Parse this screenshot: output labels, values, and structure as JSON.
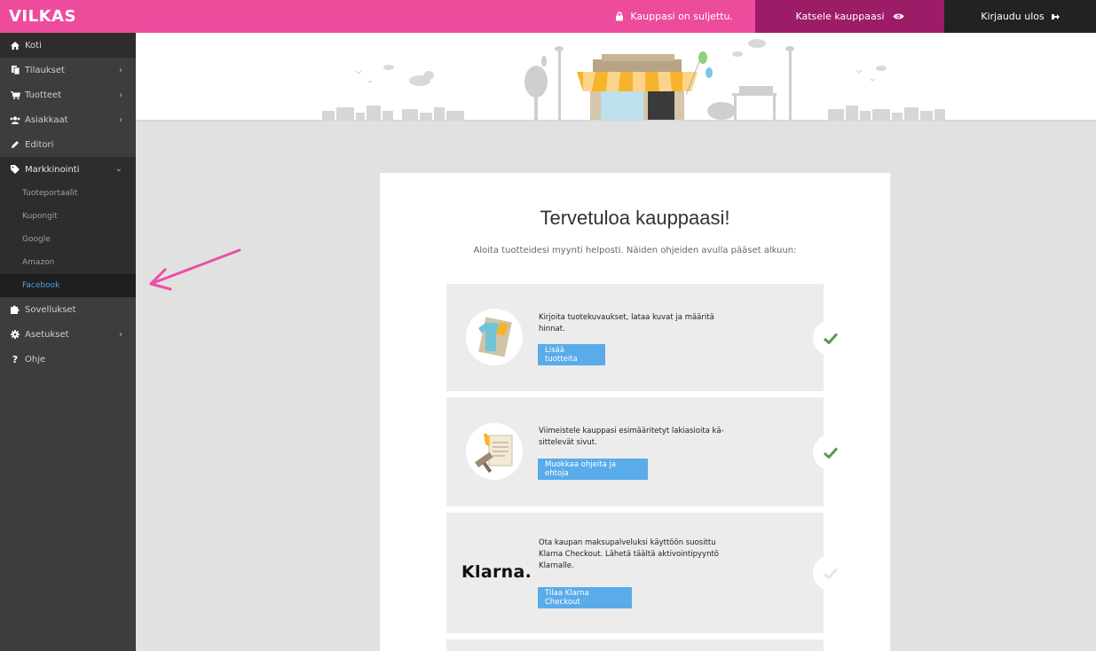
{
  "header": {
    "logo": "VILKAS",
    "store_status": "Kauppasi on suljettu.",
    "view_store": "Katsele kauppaasi",
    "logout": "Kirjaudu ulos"
  },
  "sidebar": {
    "items": [
      {
        "label": "Koti",
        "icon": "home-icon"
      },
      {
        "label": "Tilaukset",
        "icon": "orders-icon"
      },
      {
        "label": "Tuotteet",
        "icon": "cart-icon"
      },
      {
        "label": "Asiakkaat",
        "icon": "users-icon"
      },
      {
        "label": "Editori",
        "icon": "pencil-icon"
      },
      {
        "label": "Markkinointi",
        "icon": "tag-icon"
      },
      {
        "label": "Sovellukset",
        "icon": "puzzle-icon"
      },
      {
        "label": "Asetukset",
        "icon": "gear-icon"
      },
      {
        "label": "Ohje",
        "icon": "help-icon"
      }
    ],
    "marketing_sub": [
      {
        "label": "Tuoteportaalit"
      },
      {
        "label": "Kupongit"
      },
      {
        "label": "Google"
      },
      {
        "label": "Amazon"
      },
      {
        "label": "Facebook"
      }
    ]
  },
  "main": {
    "title": "Tervetuloa kauppaasi!",
    "subtitle": "Aloita tuotteidesi myynti helposti. Näiden ohjeiden avulla pääset alkuun:",
    "steps": [
      {
        "text": "Kirjoita tuotekuvaukset, lataa kuvat ja määritä hinnat.",
        "button": "Lisää tuotteita",
        "done": true
      },
      {
        "text": "Viimeistele kauppasi esimääritetyt lakiasioita kä-sittelevät sivut.",
        "button": "Muokkaa ohjeita ja ehtoja",
        "done": true
      },
      {
        "text": "Ota kaupan maksupalveluksi käyttöön suosittu Klarna Checkout. Lähetä täältä aktivointipyyntö Klarnalle.",
        "button": "Tilaa Klarna Checkout",
        "done": false,
        "logo": "Klarna."
      }
    ]
  },
  "colors": {
    "brand_pink": "#ed4c9d",
    "dark_magenta": "#9c1c68",
    "sidebar_bg": "#3d3d3d",
    "button_blue": "#5aabe9",
    "check_green": "#5a9a4a",
    "annotation_arrow": "#ee4ca6"
  }
}
